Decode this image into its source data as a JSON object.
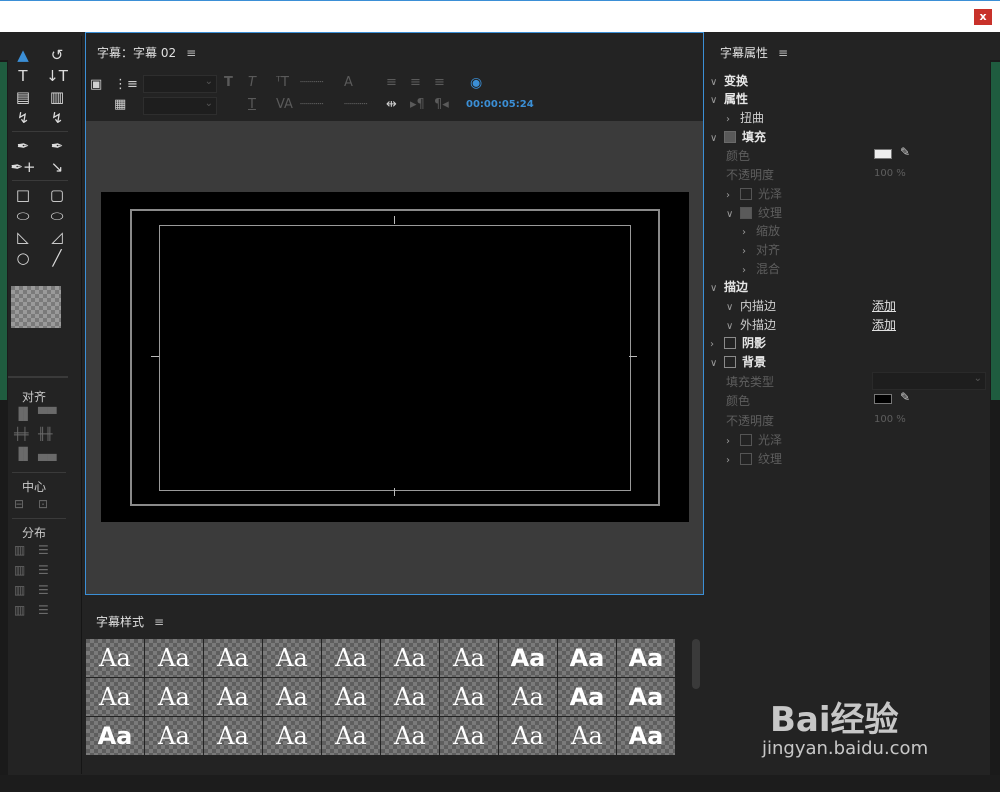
{
  "window": {
    "close_label": "x"
  },
  "tools": {
    "rows": [
      [
        "▲",
        "↺"
      ],
      [
        "T",
        "↓T"
      ],
      [
        "▤",
        "▥"
      ],
      [
        "↯",
        "↯"
      ],
      [
        "✒",
        "✒"
      ],
      [
        "✒+",
        "↘"
      ],
      [
        "□",
        "▢"
      ],
      [
        "⬭",
        "⬭"
      ],
      [
        "◺",
        "◿"
      ],
      [
        "○",
        "╱"
      ]
    ],
    "align_label": "对齐",
    "center_label": "中心",
    "distribute_label": "分布"
  },
  "title_panel": {
    "tab_label": "字幕：字幕 02",
    "menu_glyph": "≡",
    "timecode": "00:00:05:24"
  },
  "styles_panel": {
    "label": "字幕样式",
    "menu_glyph": "≡",
    "swatch_text": "Aa",
    "rows": 3,
    "cols": 10
  },
  "properties": {
    "label": "字幕属性",
    "menu_glyph": "≡",
    "transform": "变换",
    "attributes": "属性",
    "distort": "扭曲",
    "fill": "填充",
    "fill_color_label": "颜色",
    "fill_opacity_label": "不透明度",
    "fill_opacity_value": "100 %",
    "sheen": "光泽",
    "texture": "纹理",
    "scale": "缩放",
    "align": "对齐",
    "blend": "混合",
    "stroke": "描边",
    "inner_stroke": "内描边",
    "outer_stroke": "外描边",
    "add_link": "添加",
    "shadow": "阴影",
    "background": "背景",
    "fill_type_label": "填充类型",
    "bg_color_label": "颜色",
    "bg_opacity_label": "不透明度",
    "bg_opacity_value": "100 %",
    "bg_sheen": "光泽",
    "bg_texture": "纹理",
    "fill_color": "#eeeeee",
    "bg_color": "#000000"
  },
  "watermark": {
    "text": "Bai经验",
    "url": "jingyan.baidu.com"
  }
}
